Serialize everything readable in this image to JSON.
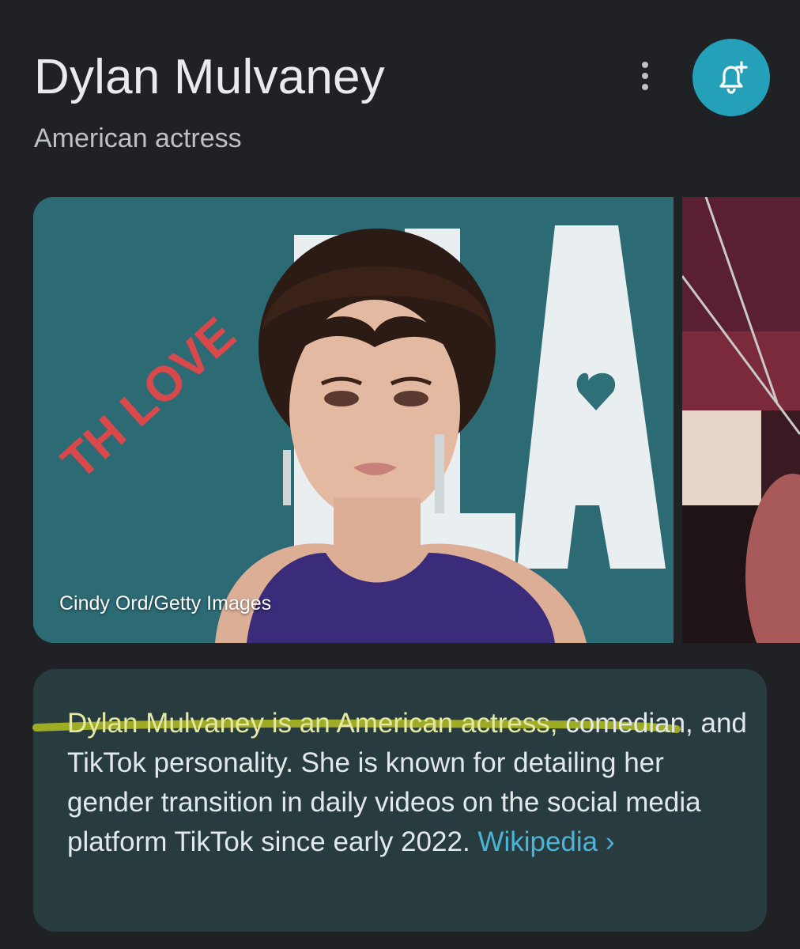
{
  "header": {
    "title": "Dylan Mulvaney",
    "subtitle": "American actress"
  },
  "actions": {
    "more_icon": "more-vert-icon",
    "follow_icon": "bell-plus-icon",
    "follow_color": "#24a0b9"
  },
  "images": {
    "credit": "Cindy Ord/Getty Images",
    "backdrop_text": "TH LOVE"
  },
  "description": {
    "first_line": "Dylan Mulvaney is an American actress,",
    "rest": "comedian, and TikTok personality. She is known for detailing her gender transition in daily videos on the social media platform TikTok since early 2022.",
    "source_link": "Wikipedia",
    "source_chevron": "›"
  },
  "colors": {
    "background": "#202124",
    "card": "#283c40",
    "link": "#4cb4d6",
    "highlight": "#c6d11c"
  }
}
